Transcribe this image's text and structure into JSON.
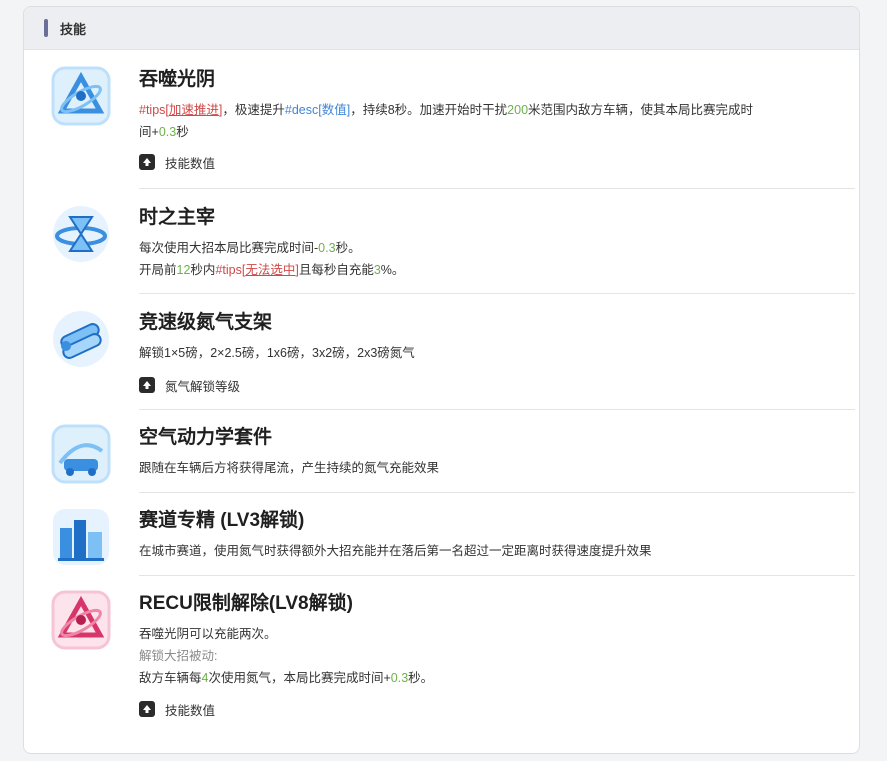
{
  "section": {
    "title": "技能"
  },
  "skills": [
    {
      "name": "吞噬光阴",
      "line1_p1": "#tips[",
      "line1_link": "加速推进",
      "line1_p2": "]",
      "line1_p3": "，极速提升",
      "line1_p4": "#desc[数值]",
      "line1_p5": "，持续8秒。加速开始时干扰",
      "line1_num1": "200",
      "line1_p6": "米范围内敌方车辆，使其本局比赛完成时",
      "line2_p1": "间+",
      "line2_num": "0.3",
      "line2_p2": "秒",
      "stat_label": "技能数值"
    },
    {
      "name": "时之主宰",
      "line1_p1": "每次使用大招本局比赛完成时间-",
      "line1_num": "0.3",
      "line1_p2": "秒。",
      "line2_p1": "开局前",
      "line2_num1": "12",
      "line2_p2": "秒内",
      "line2_tips": "#tips[",
      "line2_link": "无法选中",
      "line2_tips_end": "]",
      "line2_p3": "且每秒自充能",
      "line2_num2": "3",
      "line2_p4": "%。"
    },
    {
      "name": "竞速级氮气支架",
      "line1": "解锁1×5磅，2×2.5磅，1x6磅，3x2磅，2x3磅氮气",
      "stat_label": "氮气解锁等级"
    },
    {
      "name": "空气动力学套件",
      "line1": "跟随在车辆后方将获得尾流，产生持续的氮气充能效果"
    },
    {
      "name": "赛道专精 (LV3解锁)",
      "line1": "在城市赛道，使用氮气时获得额外大招充能并在落后第一名超过一定距离时获得速度提升效果"
    },
    {
      "name": "RECU限制解除(LV8解锁)",
      "line1": "吞噬光阴可以充能两次。",
      "line2": "解锁大招被动:",
      "line3_p1": "敌方车辆每",
      "line3_num1": "4",
      "line3_p2": "次使用氮气，本局比赛完成时间+",
      "line3_num2": "0.3",
      "line3_p3": "秒。",
      "stat_label": "技能数值"
    }
  ],
  "icons": [
    "time-devour-icon",
    "time-master-icon",
    "nitro-rack-icon",
    "aero-kit-icon",
    "track-mastery-icon",
    "recu-unlock-icon"
  ],
  "colors": {
    "tips": "#d04848",
    "desc": "#3f86d8",
    "number": "#6fb04a",
    "icon_blue": "#3a8fe0",
    "icon_pink": "#d8356a"
  }
}
